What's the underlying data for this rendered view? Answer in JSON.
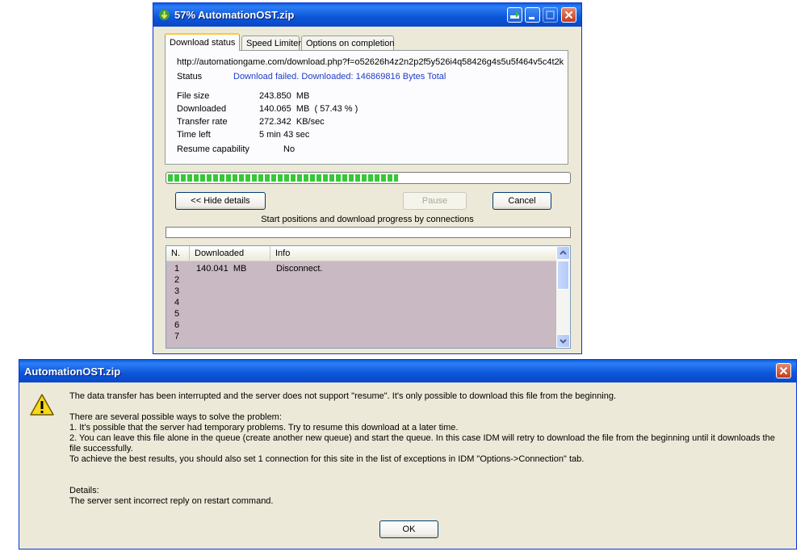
{
  "download_window": {
    "title": "57% AutomationOST.zip",
    "tabs": [
      {
        "label": "Download status",
        "active": true
      },
      {
        "label": "Speed Limiter",
        "active": false
      },
      {
        "label": "Options on completion",
        "active": false
      }
    ],
    "url": "http://automationgame.com/download.php?f=o52626h4z2n2p2f5y526i4q58426g4s5u5f464v5c4t2k",
    "status_label": "Status",
    "status_value": "Download failed. Downloaded: 146869816 Bytes Total",
    "details": {
      "file_size_label": "File size",
      "file_size_value": "243.850  MB",
      "downloaded_label": "Downloaded",
      "downloaded_value": "140.065  MB  ( 57.43 % )",
      "transfer_rate_label": "Transfer rate",
      "transfer_rate_value": "272.342  KB/sec",
      "time_left_label": "Time left",
      "time_left_value": "5 min 43 sec",
      "resume_label": "Resume capability",
      "resume_value": "No"
    },
    "progress_fraction": 0.5743,
    "buttons": {
      "hide_details": "<< Hide details",
      "pause": "Pause",
      "cancel": "Cancel"
    },
    "connections_caption": "Start positions and download progress by connections",
    "connections_table": {
      "columns": [
        "N.",
        "Downloaded",
        "Info"
      ],
      "rows": [
        {
          "n": "1",
          "downloaded": "140.041  MB",
          "info": "Disconnect."
        },
        {
          "n": "2",
          "downloaded": "",
          "info": ""
        },
        {
          "n": "3",
          "downloaded": "",
          "info": ""
        },
        {
          "n": "4",
          "downloaded": "",
          "info": ""
        },
        {
          "n": "5",
          "downloaded": "",
          "info": ""
        },
        {
          "n": "6",
          "downloaded": "",
          "info": ""
        },
        {
          "n": "7",
          "downloaded": "",
          "info": ""
        }
      ]
    }
  },
  "error_dialog": {
    "title": "AutomationOST.zip",
    "message_lines": [
      "The data transfer has been interrupted and the server does not support \"resume\". It's only possible to download this file from the beginning.",
      "There are several possible ways to solve the problem:",
      "1. It's possible that the server had temporary problems. Try to resume this download at a later time.",
      "2. You can leave this file alone in the queue (create another new queue) and start the queue. In this case IDM will retry to download the file from the beginning until it downloads the file successfully.",
      "To achieve the best results, you should also set 1 connection for this site in the list of exceptions in IDM \"Options->Connection\" tab.",
      "Details:",
      "The server sent incorrect reply on restart command."
    ],
    "ok_label": "OK"
  },
  "colors": {
    "titlebar": "#0b56d8",
    "window_bg": "#ece9d8",
    "status_blue": "#1e3cc8",
    "progress_green": "#37c837",
    "list_bg": "#c9b9c3"
  }
}
